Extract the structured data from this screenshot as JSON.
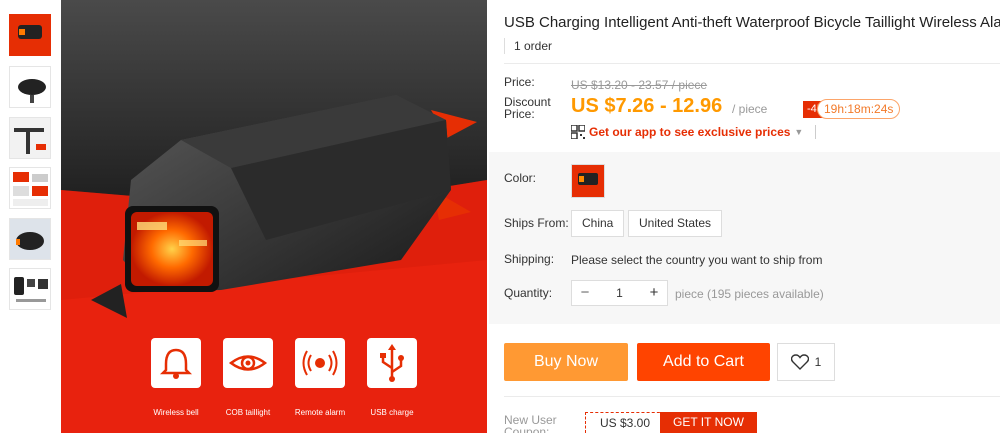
{
  "product": {
    "title": "USB Charging Intelligent Anti-theft Waterproof Bicycle Taillight Wireless Alarm",
    "orders": "1 order"
  },
  "price": {
    "label": "Price:",
    "original": "US $13.20 - 23.57 / piece",
    "discount_label": "Discount Price:",
    "discount": "US $7.26 - 12.96",
    "unit": "/ piece",
    "badge": "-45%",
    "timer": "19h:18m:24s",
    "app_link": "Get our app to see exclusive prices"
  },
  "options": {
    "color_label": "Color:",
    "ships_from_label": "Ships From:",
    "ships_from": [
      "China",
      "United States"
    ],
    "shipping_label": "Shipping:",
    "shipping_text": "Please select the country you want to ship from",
    "quantity_label": "Quantity:",
    "quantity": "1",
    "minus": "−",
    "plus": "+",
    "pieces_note": "piece (195 pieces available)"
  },
  "actions": {
    "buy_now": "Buy Now",
    "add_to_cart": "Add to Cart",
    "wishlist_count": "1"
  },
  "coupon": {
    "label": "New User Coupon:",
    "value": "US $3.00",
    "button": "GET IT NOW"
  },
  "image_features": [
    "Wireless bell",
    "COB taillight",
    "Remote alarm",
    "USB charge"
  ],
  "colors": {
    "accent_red": "#e62e04",
    "price_orange": "#ff9900",
    "buy_now": "#ff9933",
    "add_to_cart": "#ff4400"
  },
  "icons": [
    "qr-code-icon",
    "chevron-down-icon",
    "heart-icon",
    "bell-icon",
    "eye-icon",
    "alarm-icon",
    "usb-icon"
  ]
}
